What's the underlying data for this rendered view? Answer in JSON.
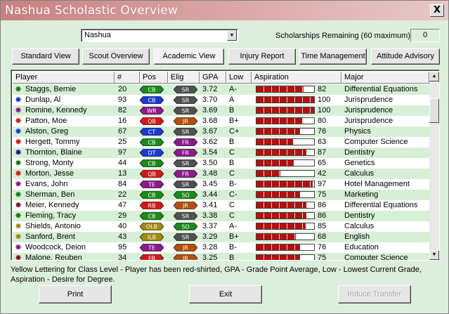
{
  "window": {
    "title": "Nashua Scholastic Overview",
    "close_label": "X"
  },
  "school_select": {
    "value": "Nashua"
  },
  "scholarships": {
    "label": "Scholarships Remaining (60 maximum)",
    "value": "0"
  },
  "tabs": [
    {
      "label": "Standard View",
      "active": false
    },
    {
      "label": "Scout Overview",
      "active": false
    },
    {
      "label": "Academic View",
      "active": true
    },
    {
      "label": "Injury Report",
      "active": false
    },
    {
      "label": "Time Management",
      "active": false
    },
    {
      "label": "Attitude Advisory",
      "active": false
    }
  ],
  "columns": [
    "Player",
    "#",
    "Pos",
    "Elig",
    "GPA",
    "Low",
    "Aspiration",
    "Major"
  ],
  "rows": [
    {
      "star": "#1a7a1a",
      "name": "Staggs, Bernie",
      "num": "20",
      "pos": "CB",
      "pos_color": "#1a8a1a",
      "elig": "SR",
      "elig_color": "#505050",
      "gpa": "3.72",
      "low": "A-",
      "asp": 82,
      "major": "Differential Equations"
    },
    {
      "star": "#1a3ad0",
      "name": "Dunlap, Al",
      "num": "93",
      "pos": "CB",
      "pos_color": "#1a3ad0",
      "elig": "SR",
      "elig_color": "#505050",
      "gpa": "3.70",
      "low": "A",
      "asp": 100,
      "major": "Jurisprudence"
    },
    {
      "star": "#8a1a8a",
      "name": "Romine, Kennedy",
      "num": "82",
      "pos": "WR",
      "pos_color": "#8a1a8a",
      "elig": "SR",
      "elig_color": "#505050",
      "gpa": "3.69",
      "low": "B",
      "asp": 100,
      "major": "Jurisprudence"
    },
    {
      "star": "#d01a1a",
      "name": "Patton, Moe",
      "num": "16",
      "pos": "QB",
      "pos_color": "#d01a1a",
      "elig": "JR",
      "elig_color": "#b05010",
      "gpa": "3.68",
      "low": "B+",
      "asp": 80,
      "major": "Jurisprudence"
    },
    {
      "star": "#1a3ad0",
      "name": "Alston, Greg",
      "num": "67",
      "pos": "CT",
      "pos_color": "#1a3ad0",
      "elig": "SR",
      "elig_color": "#505050",
      "gpa": "3.67",
      "low": "C+",
      "asp": 76,
      "major": "Physics"
    },
    {
      "star": "#d01a1a",
      "name": "Hergett, Tommy",
      "num": "25",
      "pos": "CB",
      "pos_color": "#1a8a1a",
      "elig": "FR",
      "elig_color": "#8a1a8a",
      "gpa": "3.62",
      "low": "B",
      "asp": 63,
      "major": "Computer Science"
    },
    {
      "star": "#1a1a80",
      "name": "Thornton, Blaine",
      "num": "97",
      "pos": "DT",
      "pos_color": "#1a3ad0",
      "elig": "FR",
      "elig_color": "#8a1a8a",
      "gpa": "3.54",
      "low": "C",
      "asp": 87,
      "major": "Dentistry"
    },
    {
      "star": "#1a7a1a",
      "name": "Strong, Monty",
      "num": "44",
      "pos": "CB",
      "pos_color": "#1a8a1a",
      "elig": "SR",
      "elig_color": "#505050",
      "gpa": "3.50",
      "low": "B",
      "asp": 65,
      "major": "Genetics"
    },
    {
      "star": "#d01a1a",
      "name": "Morton, Jesse",
      "num": "13",
      "pos": "QB",
      "pos_color": "#d01a1a",
      "elig": "FR",
      "elig_color": "#8a1a8a",
      "gpa": "3.48",
      "low": "C",
      "asp": 42,
      "major": "Calculus"
    },
    {
      "star": "#8a1a8a",
      "name": "Evans, John",
      "num": "84",
      "pos": "TE",
      "pos_color": "#8a1a8a",
      "elig": "SR",
      "elig_color": "#505050",
      "gpa": "3.45",
      "low": "B-",
      "asp": 97,
      "major": "Hotel Management"
    },
    {
      "star": "#1a7a1a",
      "name": "Sherman, Ben",
      "num": "22",
      "pos": "CB",
      "pos_color": "#1a8a1a",
      "elig": "SO",
      "elig_color": "#1a8a1a",
      "gpa": "3.44",
      "low": "C-",
      "asp": 75,
      "major": "Marketing"
    },
    {
      "star": "#7a1a1a",
      "name": "Meier, Kennedy",
      "num": "47",
      "pos": "RB",
      "pos_color": "#d01a1a",
      "elig": "JR",
      "elig_color": "#b05010",
      "gpa": "3.41",
      "low": "C",
      "asp": 86,
      "major": "Differential Equations"
    },
    {
      "star": "#1a7a1a",
      "name": "Fleming, Tracy",
      "num": "29",
      "pos": "CB",
      "pos_color": "#1a8a1a",
      "elig": "SR",
      "elig_color": "#505050",
      "gpa": "3.38",
      "low": "C",
      "asp": 86,
      "major": "Dentistry"
    },
    {
      "star": "#a08a10",
      "name": "Shields, Antonio",
      "num": "40",
      "pos": "OLB",
      "pos_color": "#a08a10",
      "elig": "SO",
      "elig_color": "#1a8a1a",
      "gpa": "3.37",
      "low": "A-",
      "asp": 85,
      "major": "Calculus"
    },
    {
      "star": "#a08a10",
      "name": "Sanford, Brent",
      "num": "43",
      "pos": "ILB",
      "pos_color": "#a08a10",
      "elig": "SR",
      "elig_color": "#505050",
      "gpa": "3.29",
      "low": "B+",
      "asp": 68,
      "major": "English"
    },
    {
      "star": "#8a1a8a",
      "name": "Woodcock, Deion",
      "num": "95",
      "pos": "TE",
      "pos_color": "#8a1a8a",
      "elig": "JR",
      "elig_color": "#b05010",
      "gpa": "3.28",
      "low": "B-",
      "asp": 76,
      "major": "Education"
    },
    {
      "star": "#7a1a1a",
      "name": "Malone, Reuben",
      "num": "34",
      "pos": "FB",
      "pos_color": "#d01a1a",
      "elig": "JR",
      "elig_color": "#b05010",
      "gpa": "3.25",
      "low": "B",
      "asp": 75,
      "major": "Computer Science"
    }
  ],
  "note": "Yellow Lettering for Class Level - Player has been red-shirted, GPA - Grade Point Average, Low - Lowest Current Grade, Aspiration - Desire for Degree.",
  "buttons": {
    "print": "Print",
    "exit": "Exit",
    "induce_transfer": "Induce Transfer"
  }
}
